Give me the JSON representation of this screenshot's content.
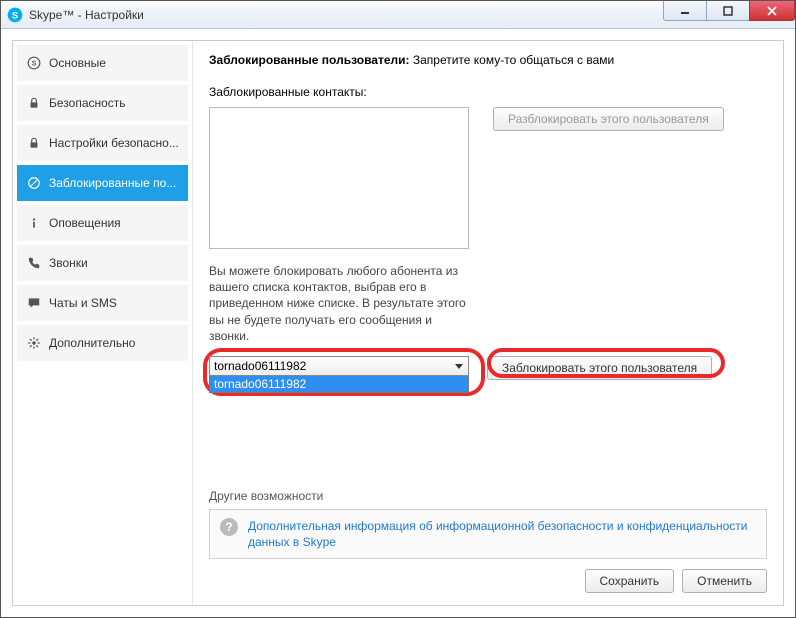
{
  "window": {
    "title": "Skype™ - Настройки"
  },
  "sidebar": {
    "items": [
      {
        "label": "Основные"
      },
      {
        "label": "Безопасность"
      },
      {
        "label": "Настройки безопасно..."
      },
      {
        "label": "Заблокированные по..."
      },
      {
        "label": "Оповещения"
      },
      {
        "label": "Звонки"
      },
      {
        "label": "Чаты и SMS"
      },
      {
        "label": "Дополнительно"
      }
    ]
  },
  "pane": {
    "heading_bold": "Заблокированные пользователи:",
    "heading_rest": " Запретите кому-то общаться с вами",
    "blocked_label": "Заблокированные контакты:",
    "unblock_btn": "Разблокировать этого пользователя",
    "description": "Вы можете блокировать любого абонента из вашего списка контактов, выбрав его в приведенном ниже списке. В результате этого вы не будете получать его сообщения и звонки.",
    "combo_selected": "tornado06111982",
    "combo_option": "tornado06111982",
    "block_btn": "Заблокировать этого пользователя",
    "other_title": "Другие возможности",
    "info_link": "Дополнительная информация об информационной безопасности и конфиденциальности данных в Skype"
  },
  "footer": {
    "save": "Сохранить",
    "cancel": "Отменить"
  }
}
